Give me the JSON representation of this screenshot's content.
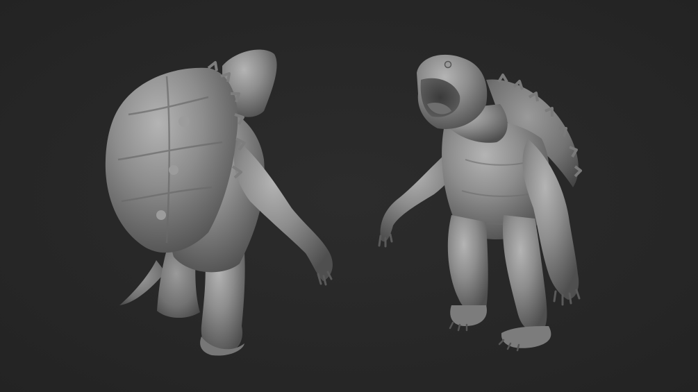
{
  "scene": {
    "background_color": "#272727",
    "model_color": "#8a8a8a",
    "figures": [
      {
        "id": "turtle-back-view",
        "description_icon": "turtle-sculpt-back"
      },
      {
        "id": "turtle-front-view",
        "description_icon": "turtle-sculpt-front"
      }
    ]
  }
}
